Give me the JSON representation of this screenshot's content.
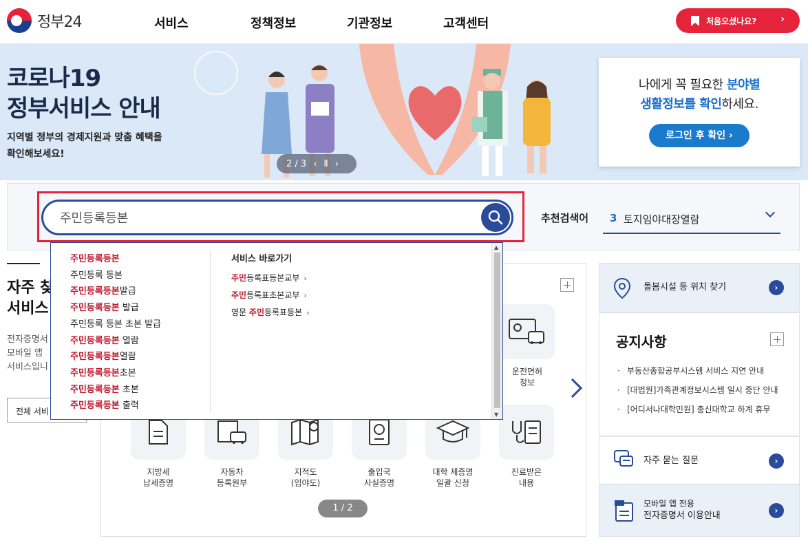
{
  "header": {
    "logo_text": "정부24",
    "nav": [
      "서비스",
      "정책정보",
      "기관정보",
      "고객센터"
    ],
    "first_visit_label": "처음오셨나요?"
  },
  "banner": {
    "title_line1": "코로나19",
    "title_line2": "정부서비스 안내",
    "sub_line1": "지역별 정부의 경제지원과 맞춤 혜택을",
    "sub_line2": "확인해보세요!",
    "slide_counter": "2 / 3"
  },
  "login_card": {
    "msg_pre": "나에게 꼭 필요한",
    "msg_hl1": "분야별",
    "msg_hl2": "생활정보를 확인",
    "msg_post": "하세요.",
    "button": "로그인 후 확인"
  },
  "search": {
    "value": "주민등록등본",
    "recommend_label": "추천검색어",
    "recommend_num": "3",
    "recommend_text": "토지임야대장열람"
  },
  "autocomplete": {
    "suggestions": [
      {
        "hl": "주민등록등본",
        "rest": ""
      },
      {
        "hl": "",
        "rest": "주민등록 등본"
      },
      {
        "hl": "주민등록등본",
        "rest": "발급"
      },
      {
        "hl": "주민등록등본",
        "rest": " 발급"
      },
      {
        "hl": "",
        "rest": "주민등록 등본 초본 발급"
      },
      {
        "hl": "주민등록등본",
        "rest": " 열람"
      },
      {
        "hl": "주민등록등본",
        "rest": "열람"
      },
      {
        "hl": "주민등록등본",
        "rest": "초본"
      },
      {
        "hl": "주민등록등본",
        "rest": " 초본"
      },
      {
        "hl": "주민등록등본",
        "rest": " 출력"
      }
    ],
    "shortcut_title": "서비스 바로가기",
    "shortcuts": [
      {
        "pre": "",
        "hl": "주민",
        "rest": "등록표등본교부"
      },
      {
        "pre": "",
        "hl": "주민",
        "rest": "등록표초본교부"
      },
      {
        "pre": "영문 ",
        "hl": "주민",
        "rest": "등록표등본"
      }
    ]
  },
  "left": {
    "title_line1": "자주 찾",
    "title_line2": "서비스",
    "desc_line1": "전자증명서",
    "desc_line2": "모바일 앱",
    "desc_line3": "서비스입니",
    "all_button": "전체 서비"
  },
  "services_row1": [
    {
      "label1": "운전면허",
      "label2": "정보"
    }
  ],
  "services_row2": [
    {
      "label1": "지방세",
      "label2": "납세증명"
    },
    {
      "label1": "자동차",
      "label2": "등록원부"
    },
    {
      "label1": "지적도",
      "label2": "(임야도)"
    },
    {
      "label1": "출입국",
      "label2": "사실증명"
    },
    {
      "label1": "대학 제증명",
      "label2": "일괄 신청"
    },
    {
      "label1": "진료받은",
      "label2": "내용"
    }
  ],
  "pager": "1 / 2",
  "right": {
    "care_facility": "돌봄시설 등 위치 찾기",
    "notice_title": "공지사항",
    "notices": [
      "부동산종합공부시스템 서비스 지연 안내",
      "[대법원]가족관계정보시스템 일시 중단 안내",
      "[어디서나대학민원] 총신대학교 하계 휴무"
    ],
    "faq": "자주 묻는 질문",
    "mobile_line1": "모바일 앱 전용",
    "mobile_line2": "전자증명서 이용안내"
  },
  "colors": {
    "brand_red": "#e5243b",
    "brand_navy": "#2a4a9a",
    "accent_blue": "#1a6fc9"
  }
}
